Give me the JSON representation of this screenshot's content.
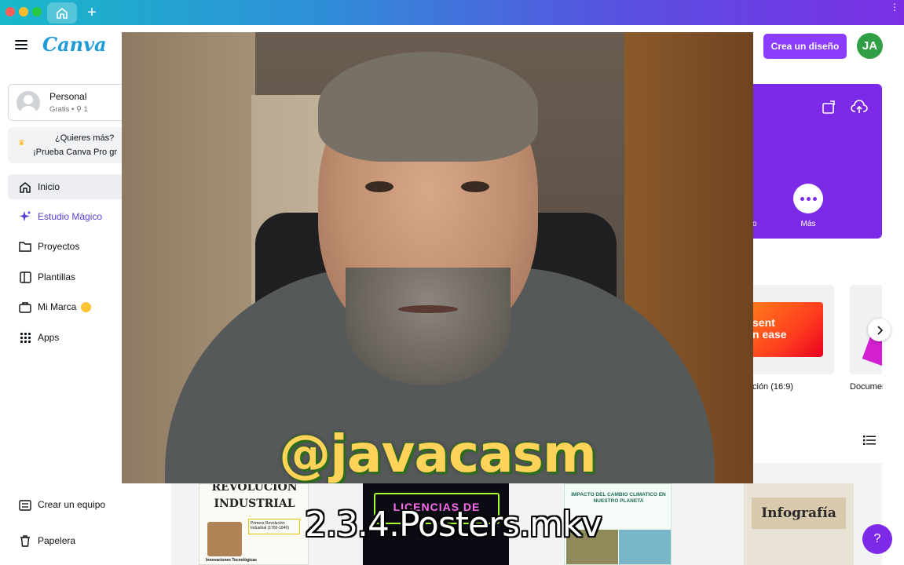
{
  "header": {
    "logo": "Canva",
    "create_button": "Crea un diseño",
    "avatar_initials": "JA"
  },
  "account": {
    "name": "Personal",
    "meta": "Gratis • ⚲ 1"
  },
  "promo": {
    "line1": "¿Quieres más?",
    "line2": "¡Prueba Canva Pro gr"
  },
  "nav": {
    "items": [
      {
        "label": "Inicio",
        "icon": "home-icon"
      },
      {
        "label": "Estudio Mágico",
        "icon": "sparkle-icon"
      },
      {
        "label": "Proyectos",
        "icon": "folder-icon"
      },
      {
        "label": "Plantillas",
        "icon": "templates-icon"
      },
      {
        "label": "Mi Marca",
        "icon": "brand-icon"
      },
      {
        "label": "Apps",
        "icon": "apps-grid-icon"
      }
    ]
  },
  "bottom_nav": {
    "create_team": "Crear un equipo",
    "trash": "Papelera"
  },
  "hero": {
    "fragment": "o",
    "more_label": "Más"
  },
  "templates": {
    "card1_text": "sent\nn ease",
    "card1_label": "ción (16:9)",
    "card2_label": "Documen"
  },
  "posters": {
    "p1_title": "REVOLUCIÓN\nINDUSTRIAL",
    "p1_box": "Primera Revolución Industrial (1760-1840)",
    "p1_footer": "Innovaciones Tecnológicas",
    "p2_title": "LICENCIAS DE",
    "p3_title": "IMPACTO DEL CAMBIO CLIMATICO EN NUESTRO PLANETA",
    "p4_title": "Infografía"
  },
  "overlay": {
    "handle": "@javacasm",
    "filename": "2.3.4.Posters.mkv"
  },
  "help": "?",
  "colors": {
    "brand_purple": "#8b3dff",
    "avatar_green": "#2f9e44",
    "logo_blue": "#1f9bd6"
  }
}
